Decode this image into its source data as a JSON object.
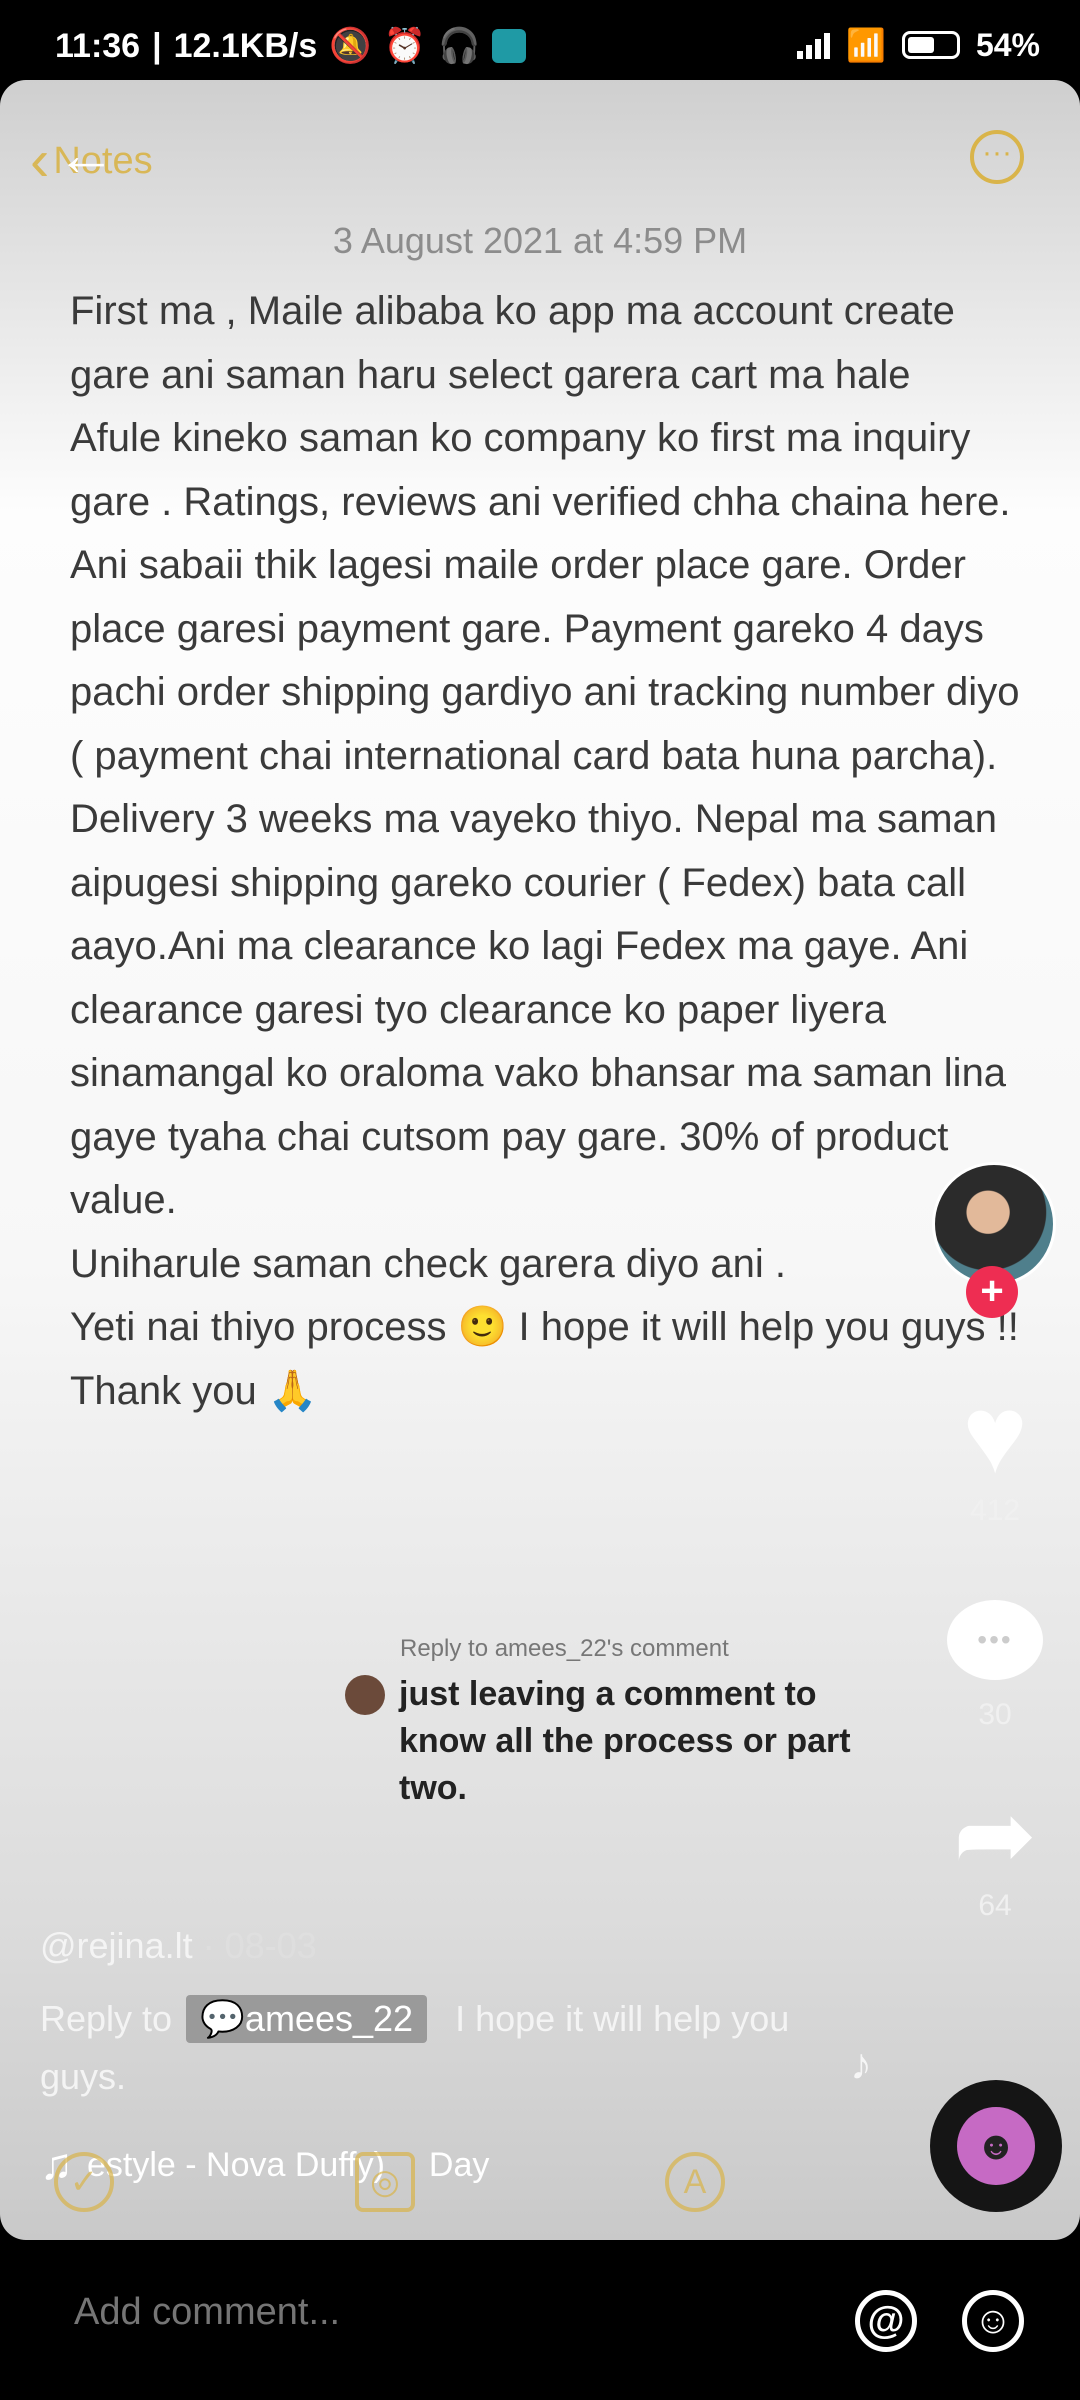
{
  "status_bar": {
    "time": "11:36",
    "speed": "12.1KB/s",
    "battery": "54%"
  },
  "notes": {
    "back_label": "Notes",
    "date": "3 August 2021 at 4:59 PM",
    "paragraphs": [
      "First ma , Maile alibaba ko app ma account create gare ani saman haru select garera cart ma hale",
      "Afule kineko saman ko company ko first ma inquiry gare . Ratings, reviews ani verified chha chaina here. Ani sabaii thik lagesi maile order place gare. Order place garesi payment gare. Payment gareko 4 days pachi order shipping gardiyo ani tracking number diyo ( payment chai international card bata huna parcha). Delivery 3 weeks ma vayeko thiyo. Nepal ma saman aipugesi shipping gareko courier ( Fedex) bata call aayo.Ani ma clearance ko lagi Fedex ma gaye. Ani clearance garesi tyo clearance ko paper liyera sinamangal ko oraloma vako bhansar ma saman lina gaye tyaha chai cutsom pay gare. 30% of product value.",
      "Uniharule saman check garera diyo ani .",
      "Yeti nai thiyo process 🙂 I hope it will help you guys !! Thank you 🙏"
    ]
  },
  "reply_overlay": {
    "label": "Reply to amees_22's comment",
    "text": "just leaving a comment to know all the process or part two."
  },
  "rail": {
    "likes": "412",
    "comments": "30",
    "shares": "64"
  },
  "post": {
    "username": "@rejina.lt",
    "date": "· 08-03",
    "reply_prefix": "Reply to",
    "reply_user": "amees_22",
    "caption": "I hope it will help you guys.",
    "music": "estyle - Nova Duffy)",
    "music_tail": "Day"
  },
  "comment_bar": {
    "placeholder": "Add comment..."
  }
}
